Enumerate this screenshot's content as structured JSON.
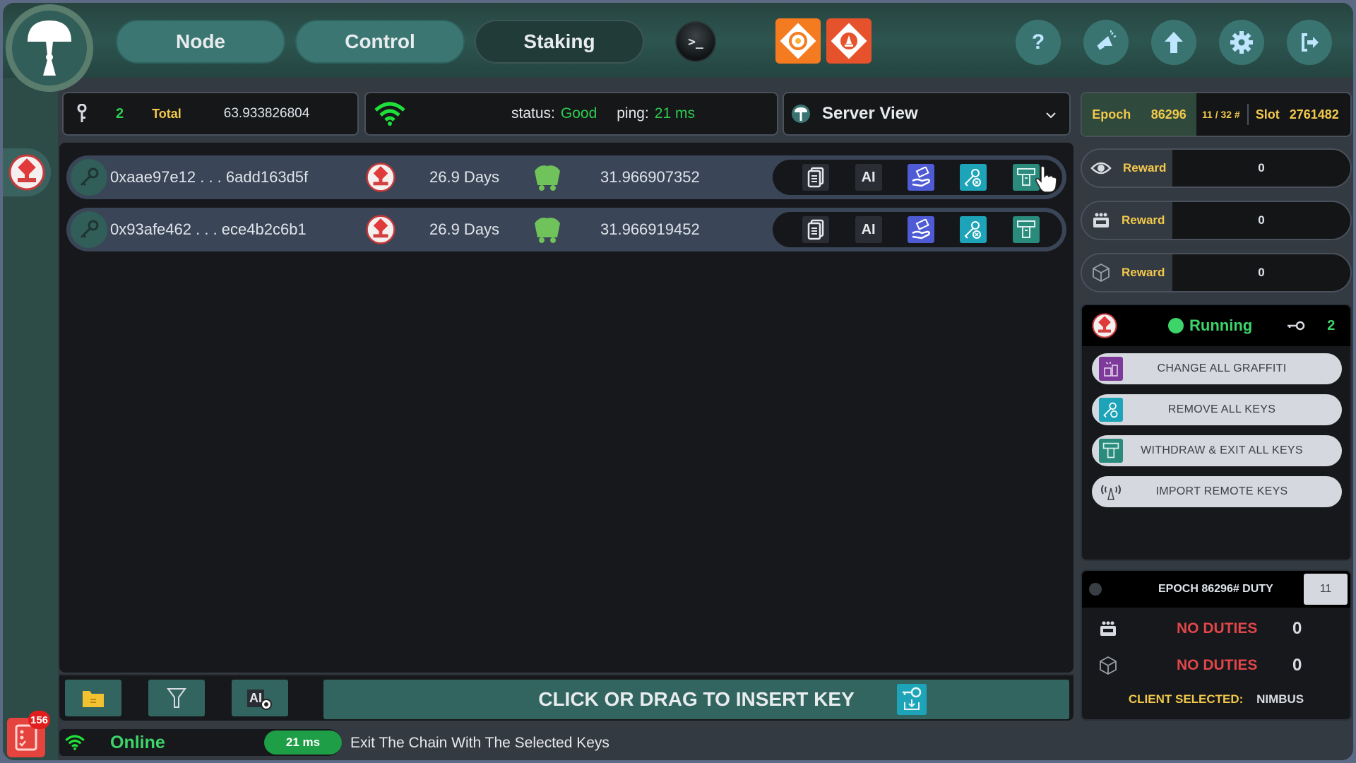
{
  "header": {
    "logo_icon": "mushroom-logo-icon",
    "tabs": [
      {
        "label": "Node",
        "active": false
      },
      {
        "label": "Control",
        "active": false
      },
      {
        "label": "Staking",
        "active": true
      }
    ],
    "terminal_glyph": ">_",
    "app_tiles": [
      {
        "name": "grafana",
        "icon": "grafana-icon",
        "color": "#f47b20"
      },
      {
        "name": "prometheus",
        "icon": "prometheus-icon",
        "color": "#e6522c"
      }
    ],
    "round_buttons": [
      {
        "name": "help",
        "icon": "question-icon",
        "glyph": "?"
      },
      {
        "name": "announcements",
        "icon": "megaphone-icon"
      },
      {
        "name": "update",
        "icon": "arrow-up-icon"
      },
      {
        "name": "settings",
        "icon": "gear-icon"
      },
      {
        "name": "logout",
        "icon": "logout-icon"
      }
    ]
  },
  "sidebar": {
    "plugin_icon": "nimbus-client-icon",
    "notifications": {
      "icon": "notification-list-icon",
      "count": "156"
    }
  },
  "summary": {
    "key_count": "2",
    "total_label": "Total",
    "total_value": "63.933826804"
  },
  "connection": {
    "status_label": "status:",
    "status_value": "Good",
    "ping_label": "ping:",
    "ping_value": "21 ms"
  },
  "server_view": {
    "label": "Server View"
  },
  "keys": [
    {
      "pubkey": "0xaae97e12 . . . 6add163d5f",
      "client_icon": "nimbus-client-icon",
      "active_time": "26.9 Days",
      "status_icon": "minecart-icon",
      "balance": "31.966907352"
    },
    {
      "pubkey": "0x93afe462 . . . ece4b2c6b1",
      "client_icon": "nimbus-client-icon",
      "active_time": "26.9 Days",
      "status_icon": "minecart-icon",
      "balance": "31.966919452"
    }
  ],
  "row_actions": [
    {
      "name": "copy",
      "icon": "copy-icon"
    },
    {
      "name": "ai",
      "icon": "ai-icon",
      "glyph": "AI"
    },
    {
      "name": "fee-recipient",
      "icon": "hand-money-icon"
    },
    {
      "name": "remove-key",
      "icon": "key-remove-icon"
    },
    {
      "name": "withdraw-exit",
      "icon": "withdraw-exit-icon"
    }
  ],
  "toolbar": {
    "insert_label": "CLICK OR DRAG TO INSERT KEY",
    "ai_glyph": "AI"
  },
  "status_bar": {
    "online_label": "Online",
    "ping": "21 ms",
    "hint": "Exit The Chain With The Selected Keys"
  },
  "epoch": {
    "label": "Epoch",
    "value": "86296",
    "slot_progress": "11 / 32 #",
    "slot_label": "Slot",
    "slot_value": "2761482"
  },
  "rewards": [
    {
      "icon": "eye-icon",
      "label": "Reward",
      "value": "0"
    },
    {
      "icon": "committee-icon",
      "label": "Reward",
      "value": "0"
    },
    {
      "icon": "cube-icon",
      "label": "Reward",
      "value": "0"
    }
  ],
  "control": {
    "status": "Running",
    "key_count": "2",
    "buttons": [
      {
        "name": "change-all-graffiti",
        "label": "CHANGE ALL GRAFFITI",
        "color": "#7e3a9a"
      },
      {
        "name": "remove-all-keys",
        "label": "REMOVE ALL KEYS",
        "color": "#1ea4b8"
      },
      {
        "name": "withdraw-exit-all-keys",
        "label": "WITHDRAW & EXIT ALL KEYS",
        "color": "#2a8a7c"
      },
      {
        "name": "import-remote-keys",
        "label": "IMPORT REMOTE KEYS",
        "color": "#d5d8de"
      }
    ]
  },
  "duty": {
    "title": "EPOCH 86296# DUTY",
    "slot_box": "11",
    "rows": [
      {
        "icon": "committee-icon",
        "label": "NO DUTIES",
        "count": "0"
      },
      {
        "icon": "cube-icon",
        "label": "NO DUTIES",
        "count": "0"
      }
    ],
    "client_label": "CLIENT SELECTED:",
    "client_value": "NIMBUS"
  },
  "colors": {
    "accent_teal": "#3b7672",
    "good_green": "#2ecc50",
    "label_yellow": "#f2c94c",
    "no_duty_red": "#e0464a"
  }
}
